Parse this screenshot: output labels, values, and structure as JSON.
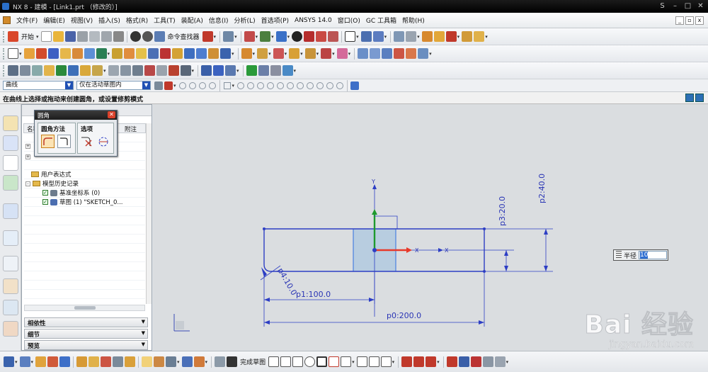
{
  "window": {
    "title": "NX 8 - 建模 - [Link1.prt （修改的）]",
    "right_label": "S"
  },
  "menu": [
    "文件(F)",
    "编辑(E)",
    "视图(V)",
    "插入(S)",
    "格式(R)",
    "工具(T)",
    "装配(A)",
    "信息(I)",
    "分析(L)",
    "首选项(P)",
    "ANSYS 14.0",
    "窗口(O)",
    "GC 工具箱",
    "帮助(H)"
  ],
  "toolbar1": {
    "start": "开始",
    "command_finder": "命令查找器"
  },
  "selection": {
    "filter": "曲线",
    "scope": "仅在活动草图内"
  },
  "cue": "在曲线上选择或拖动来创建圆角，或设置修剪模式",
  "navigator": {
    "col_name": "名称",
    "col_note": "附注",
    "items": [
      {
        "label": "用户表达式"
      },
      {
        "label": "模型历史记录"
      },
      {
        "label": "基准坐标系 (0)"
      },
      {
        "label": "草图 (1) \"SKETCH_0..."
      }
    ],
    "panels": [
      "相依性",
      "细节",
      "预览"
    ]
  },
  "fillet_dialog": {
    "title": "圆角",
    "group_method": "圆角方法",
    "group_options": "选项"
  },
  "radius_input": {
    "label": "半径",
    "value": "10"
  },
  "dimensions": {
    "p0": "p0:200.0",
    "p1": "p1:100.0",
    "p2": "p2:40.0",
    "p3": "p3:20.0",
    "p4": "p4:10.0"
  },
  "axes": {
    "x": "X",
    "y": "Y"
  },
  "watermark": {
    "brand": "Bai 经验",
    "url": "jingyan.baidu.com"
  },
  "bottom": {
    "finish_sketch": "完成草图"
  },
  "colors": {
    "sketch": "#2d3ec4",
    "constraint": "#e8392a",
    "axis_y": "#1e9a2e",
    "rect_fill": "#b8cde0"
  }
}
